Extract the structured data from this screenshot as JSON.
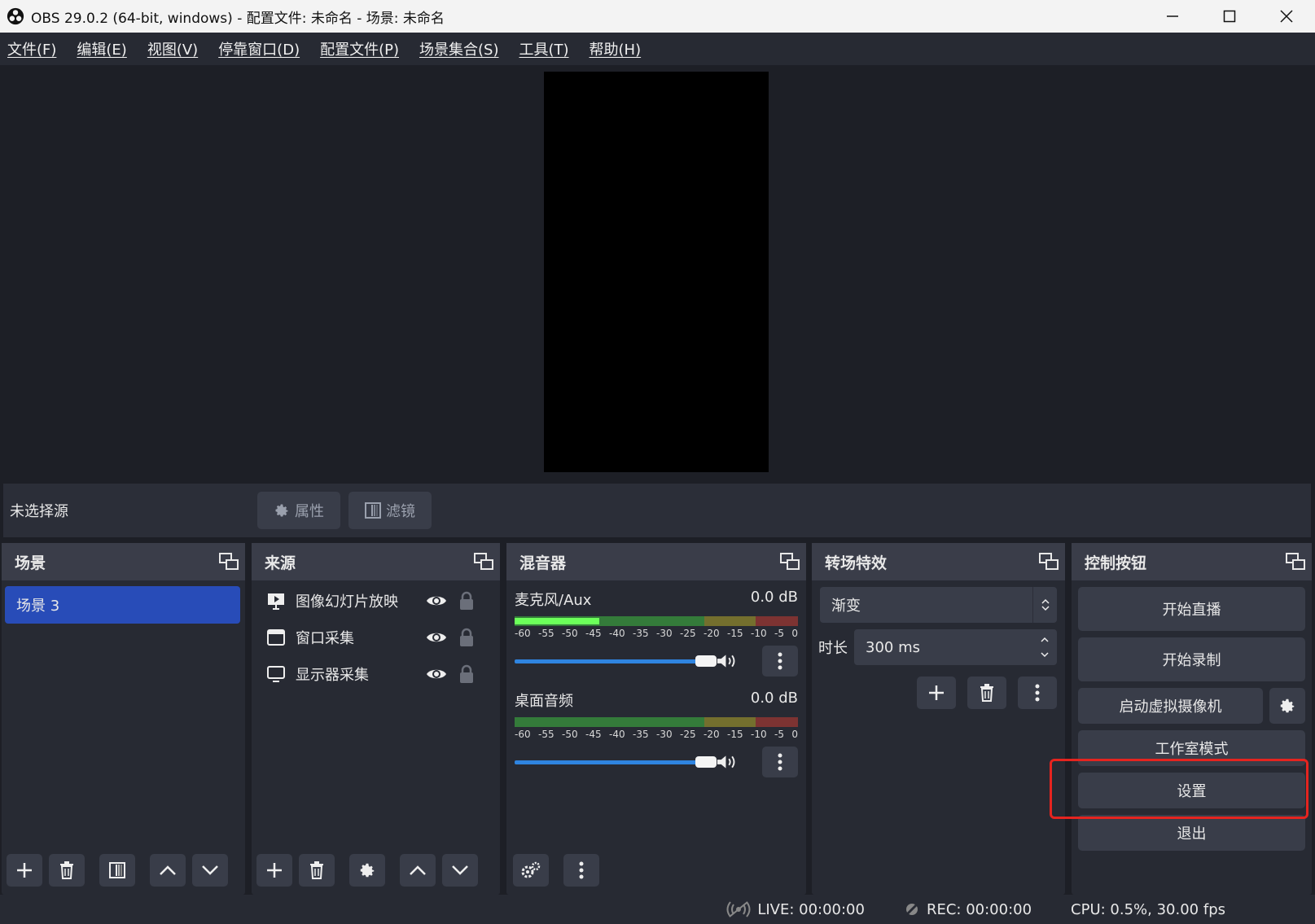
{
  "window": {
    "title": "OBS 29.0.2 (64-bit, windows) - 配置文件: 未命名 - 场景: 未命名",
    "minimize": "—",
    "maximize": "☐",
    "close": "✕"
  },
  "menu": [
    "文件(F)",
    "编辑(E)",
    "视图(V)",
    "停靠窗口(D)",
    "配置文件(P)",
    "场景集合(S)",
    "工具(T)",
    "帮助(H)"
  ],
  "source_toolbar": {
    "no_selection": "未选择源",
    "properties_label": "属性",
    "filters_label": "滤镜"
  },
  "scenes": {
    "title": "场景",
    "items": [
      "场景 3"
    ]
  },
  "sources": {
    "title": "来源",
    "items": [
      {
        "label": "图像幻灯片放映",
        "icon": "slideshow-icon"
      },
      {
        "label": "窗口采集",
        "icon": "window-icon"
      },
      {
        "label": "显示器采集",
        "icon": "monitor-icon"
      }
    ]
  },
  "mixer": {
    "title": "混音器",
    "ticks": [
      "-60",
      "-55",
      "-50",
      "-45",
      "-40",
      "-35",
      "-30",
      "-25",
      "-20",
      "-15",
      "-10",
      "-5",
      "0"
    ],
    "channels": [
      {
        "name": "麦克风/Aux",
        "db": "0.0 dB",
        "level": 0.3
      },
      {
        "name": "桌面音频",
        "db": "0.0 dB",
        "level": 0.0
      }
    ]
  },
  "transitions": {
    "title": "转场特效",
    "selected": "渐变",
    "duration_label": "时长",
    "duration_value": "300 ms"
  },
  "controls": {
    "title": "控制按钮",
    "start_stream": "开始直播",
    "start_record": "开始录制",
    "virtual_cam": "启动虚拟摄像机",
    "studio_mode": "工作室模式",
    "settings": "设置",
    "exit": "退出"
  },
  "status": {
    "live": "LIVE: 00:00:00",
    "rec": "REC: 00:00:00",
    "cpu": "CPU: 0.5%, 30.00 fps"
  },
  "colors": {
    "accent_blue": "#284cb8",
    "highlight_red": "#e5241f",
    "meter_green": "#3fbd3f",
    "meter_yellow": "#b5a82a",
    "meter_red": "#c43a32"
  }
}
